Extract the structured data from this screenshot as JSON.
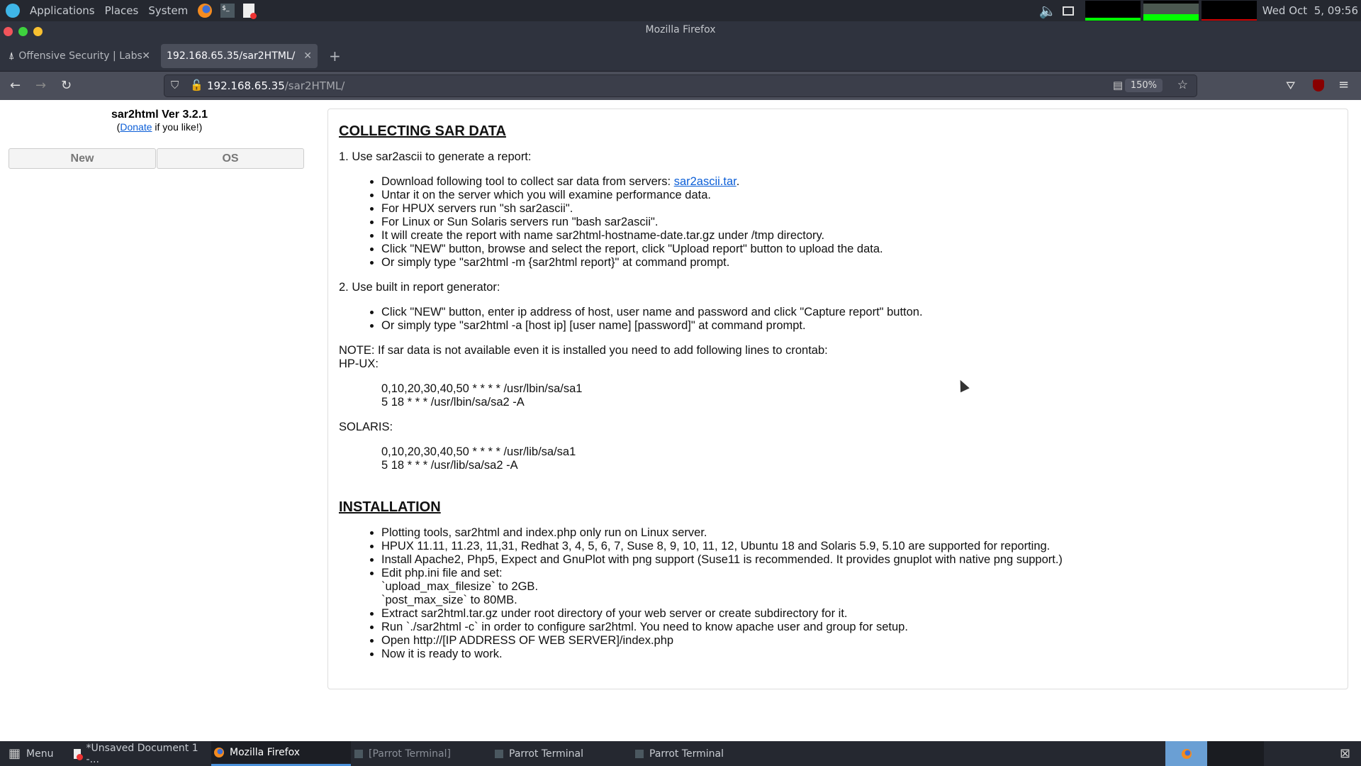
{
  "top_panel": {
    "applications": "Applications",
    "places": "Places",
    "system": "System",
    "clock": "Wed Oct  5, 09:56"
  },
  "window": {
    "title": "Mozilla Firefox"
  },
  "tabs": [
    {
      "label": "Offensive Security | Labs"
    },
    {
      "label": "192.168.65.35/sar2HTML/"
    }
  ],
  "toolbar": {
    "url_host": "192.168.65.35",
    "url_path": "/sar2HTML/",
    "zoom": "150%"
  },
  "sidebar": {
    "title": "sar2html Ver 3.2.1",
    "donate_pre": "(",
    "donate_link": "Donate",
    "donate_post": " if you like!)",
    "new_button": "New",
    "os_button": "OS"
  },
  "main": {
    "heading1": "COLLECTING SAR DATA",
    "step1": "1. Use sar2ascii to generate a report:",
    "step1_first_pre": "Download following tool to collect sar data from servers: ",
    "step1_first_link": "sar2ascii.tar",
    "step1_first_post": ".",
    "step1_items": [
      "Untar it on the server which you will examine performance data.",
      "For HPUX servers run \"sh sar2ascii\".",
      "For Linux or Sun Solaris servers run \"bash sar2ascii\".",
      "It will create the report with name sar2html-hostname-date.tar.gz under /tmp directory.",
      "Click \"NEW\" button, browse and select the report, click \"Upload report\" button to upload the data.",
      "Or simply type \"sar2html -m {sar2html report}\" at command prompt."
    ],
    "step2": "2. Use built in report generator:",
    "step2_items": [
      "Click \"NEW\" button, enter ip address of host, user name and password and click \"Capture report\" button.",
      "Or simply type \"sar2html -a [host ip] [user name] [password]\" at command prompt."
    ],
    "note": "NOTE: If sar data is not available even it is installed you need to add following lines to crontab:",
    "hpux_label": "HP-UX:",
    "hpux_lines": [
      "0,10,20,30,40,50 * * * * /usr/lbin/sa/sa1",
      "5 18 * * * /usr/lbin/sa/sa2 -A"
    ],
    "solaris_label": "SOLARIS:",
    "solaris_lines": [
      "0,10,20,30,40,50 * * * * /usr/lib/sa/sa1",
      "5 18 * * * /usr/lib/sa/sa2 -A"
    ],
    "heading2": "INSTALLATION",
    "install_items": [
      "Plotting tools, sar2html and index.php only run on Linux server.",
      "HPUX 11.11, 11.23, 11,31, Redhat 3, 4, 5, 6, 7, Suse 8, 9, 10, 11, 12, Ubuntu 18 and Solaris 5.9, 5.10 are supported for reporting.",
      "Install Apache2, Php5, Expect and GnuPlot with png support (Suse11 is recommended. It provides gnuplot with native png support.)",
      "Edit php.ini file and set:",
      "`upload_max_filesize` to 2GB.",
      "`post_max_size` to 80MB.",
      "Extract sar2html.tar.gz under root directory of your web server or create subdirectory for it.",
      "Run `./sar2html -c` in order to configure sar2html. You need to know apache user and group for setup.",
      "Open http://[IP ADDRESS OF WEB SERVER]/index.php",
      "Now it is ready to work."
    ]
  },
  "taskbar": {
    "menu": "Menu",
    "items": [
      "*Unsaved Document 1 -...",
      "Mozilla Firefox",
      "[Parrot Terminal]",
      "Parrot Terminal",
      "Parrot Terminal"
    ]
  }
}
